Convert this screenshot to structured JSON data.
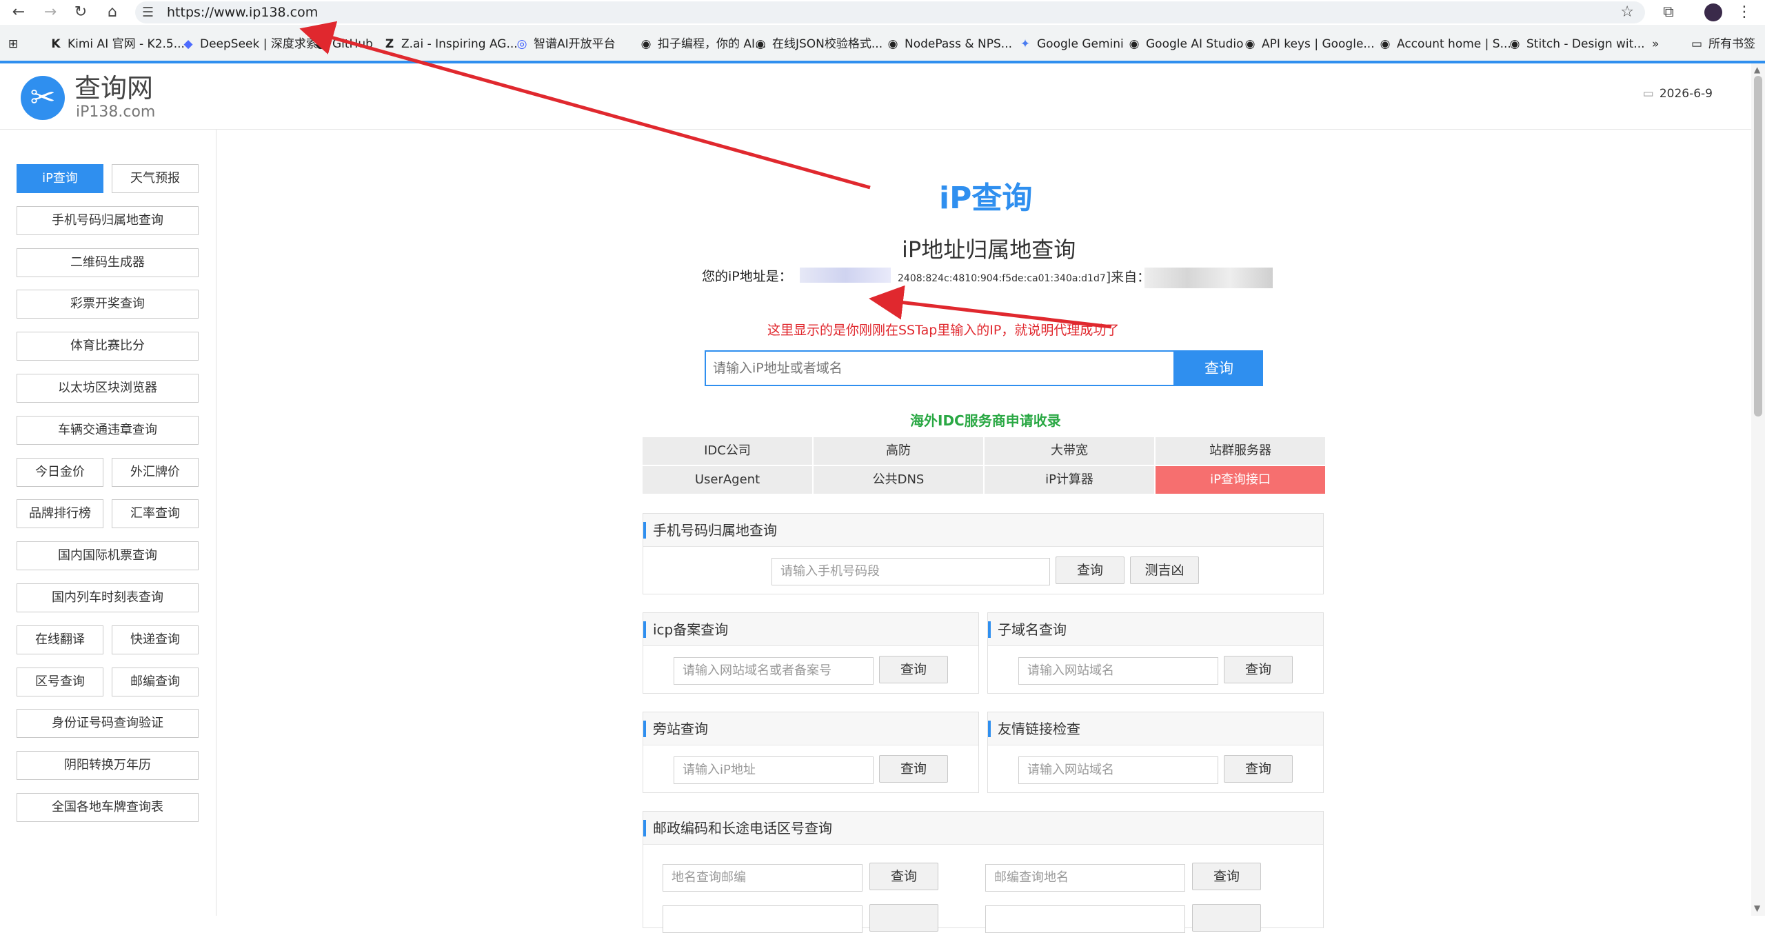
{
  "browser": {
    "url": "https://www.ip138.com",
    "bookmarks": [
      {
        "label": "Kimi AI 官网 - K2.5...",
        "icon": "kimi-icon"
      },
      {
        "label": "DeepSeek | 深度求索",
        "icon": "deepseek-icon"
      },
      {
        "label": "GitHub",
        "icon": "github-icon"
      },
      {
        "label": "Z.ai - Inspiring AG...",
        "icon": "zai-icon"
      },
      {
        "label": "智谱AI开放平台",
        "icon": "zhipu-icon"
      },
      {
        "label": "扣子编程，你的 AI...",
        "icon": "globe-icon"
      },
      {
        "label": "在线JSON校验格式...",
        "icon": "globe-icon"
      },
      {
        "label": "NodePass & NPS...",
        "icon": "globe-icon"
      },
      {
        "label": "Google Gemini",
        "icon": "gemini-icon"
      },
      {
        "label": "Google AI Studio",
        "icon": "globe-icon"
      },
      {
        "label": "API keys | Google...",
        "icon": "globe-icon"
      },
      {
        "label": "Account home | S...",
        "icon": "globe-icon"
      },
      {
        "label": "Stitch - Design wit...",
        "icon": "globe-icon"
      }
    ],
    "all_bookmarks": "所有书签",
    "more": "»"
  },
  "header": {
    "site_name": "查询网",
    "site_domain": "iP138.com",
    "date": "2026-6-9"
  },
  "sidebar": {
    "items": [
      "iP查询",
      "天气预报",
      "手机号码归属地查询",
      "二维码生成器",
      "彩票开奖查询",
      "体育比赛比分",
      "以太坊区块浏览器",
      "车辆交通违章查询",
      "今日金价",
      "外汇牌价",
      "品牌排行榜",
      "汇率查询",
      "国内国际机票查询",
      "国内列车时刻表查询",
      "在线翻译",
      "快递查询",
      "区号查询",
      "邮编查询",
      "身份证号码查询验证",
      "阴阳转换万年历",
      "全国各地车牌查询表"
    ]
  },
  "main": {
    "title": "iP查询",
    "subtitle": "iP地址归属地查询",
    "my_ip_prefix": "您的iP地址是：",
    "ip_visible": "2408:824c:4810:904:f5de:ca01:340a:d1d7",
    "from": "]来自：",
    "note": "这里显示的是你刚刚在SSTap里输入的IP，就说明代理成功了",
    "search_placeholder": "请输入iP地址或者域名",
    "search_button": "查询",
    "idc_title": "海外IDC服务商申请收录",
    "links": [
      "IDC公司",
      "高防",
      "大带宽",
      "站群服务器",
      "UserAgent",
      "公共DNS",
      "iP计算器",
      "iP查询接口"
    ]
  },
  "panels": {
    "phone": {
      "title": "手机号码归属地查询",
      "placeholder": "请输入手机号码段",
      "query": "查询",
      "fortune": "测吉凶"
    },
    "icp": {
      "title": "icp备案查询",
      "placeholder": "请输入网站域名或者备案号",
      "query": "查询"
    },
    "subdomain": {
      "title": "子域名查询",
      "placeholder": "请输入网站域名",
      "query": "查询"
    },
    "sidesite": {
      "title": "旁站查询",
      "placeholder": "请输入iP地址",
      "query": "查询"
    },
    "friendlink": {
      "title": "友情链接检查",
      "placeholder": "请输入网站域名",
      "query": "查询"
    },
    "postal": {
      "title": "邮政编码和长途电话区号查询",
      "placeholder_left": "地名查询邮编",
      "placeholder_right": "邮编查询地名",
      "query": "查询"
    }
  },
  "colors": {
    "accent": "#2f8fef",
    "annotation": "#e0282e",
    "idc_green": "#2aa844",
    "highlight": "#f66f6f"
  }
}
